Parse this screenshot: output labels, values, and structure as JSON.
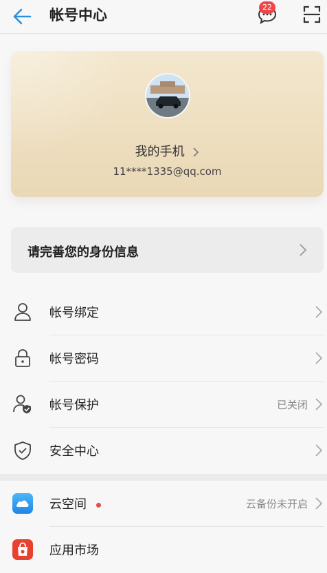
{
  "header": {
    "title": "帐号中心",
    "message_badge": "22"
  },
  "account_card": {
    "name": "我的手机",
    "email": "11****1335@qq.com"
  },
  "notice": {
    "text": "请完善您的身份信息"
  },
  "menu": [
    {
      "label": "帐号绑定",
      "icon": "person-icon",
      "status": ""
    },
    {
      "label": "帐号密码",
      "icon": "lock-icon",
      "status": ""
    },
    {
      "label": "帐号保护",
      "icon": "person-shield-icon",
      "status": "已关闭"
    },
    {
      "label": "安全中心",
      "icon": "shield-icon",
      "status": ""
    }
  ],
  "services": [
    {
      "label": "云空间",
      "icon": "cloud-icon",
      "status": "云备份未开启",
      "dot": true
    },
    {
      "label": "应用市场",
      "icon": "app-market-icon",
      "status": ""
    }
  ],
  "colors": {
    "accent_blue": "#2b8fe0",
    "badge_red": "#f0464a",
    "card_gold": "#ead8b6"
  }
}
